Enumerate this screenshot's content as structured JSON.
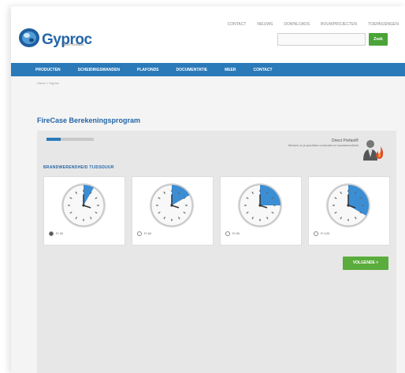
{
  "header": {
    "top_links": [
      "CONTACT",
      "NIEUWS",
      "DOWNLOADS",
      "BOUWPROJECTEN",
      "TOEPASSINGEN"
    ],
    "logo_text": "Gyproc",
    "logo_sub": "SAINT-GOBAIN",
    "search": {
      "placeholder": "",
      "button_label": "Zoek"
    }
  },
  "nav": {
    "items": [
      "PRODUCTEN",
      "SCHEIDINGSWANDEN",
      "PLAFONDS",
      "DOCUMENTATIE",
      "MEER",
      "CONTACT"
    ]
  },
  "breadcrumb": "Home > Gyproc",
  "main": {
    "title": "FireCase Berekeningsprogram",
    "progress": {
      "label": "",
      "fraction": 0.3
    },
    "consult": {
      "title": "Direct Prefast®",
      "subtitle": "Bereken nu je specifieke constructie en brandwerendheid"
    },
    "section_label": "BRANDWERENDHEID TIJDSDUUR",
    "options": [
      {
        "label": "Ft 30",
        "selected": true,
        "minutes": 5
      },
      {
        "label": "Ft 60",
        "selected": false,
        "minutes": 10
      },
      {
        "label": "Ft 90",
        "selected": false,
        "minutes": 15
      },
      {
        "label": "Ft 120",
        "selected": false,
        "minutes": 20
      }
    ],
    "next_button": "VOLGENDE >"
  },
  "colors": {
    "brand_blue": "#2a79b8",
    "green": "#5aac3c",
    "clock_wedge": "#3b8ed4"
  }
}
